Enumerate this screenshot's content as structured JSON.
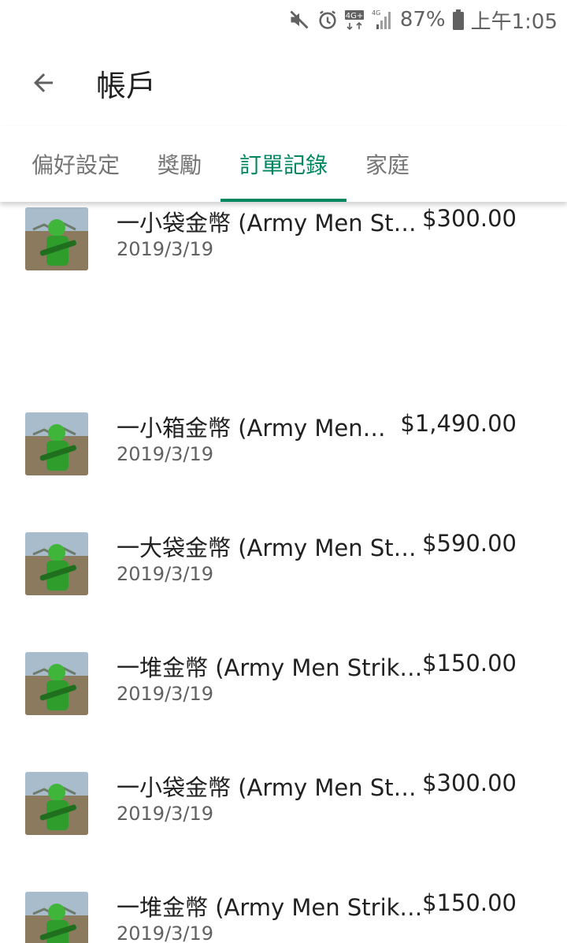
{
  "status_bar": {
    "battery": "87%",
    "time": "上午1:05",
    "network": "4G",
    "icons": [
      "mute-icon",
      "alarm-icon",
      "4g-icon",
      "signal-icon",
      "battery-icon"
    ]
  },
  "app_bar": {
    "title": "帳戶",
    "back_icon": "arrow-back-icon"
  },
  "tabs": [
    {
      "label": "偏好設定",
      "active": false
    },
    {
      "label": "獎勵",
      "active": false
    },
    {
      "label": "訂單記錄",
      "active": true
    },
    {
      "label": "家庭",
      "active": false
    }
  ],
  "accent_color": "#01875f",
  "orders": [
    {
      "title": "一小袋金幣 (Army Men St…",
      "price": "$300.00",
      "date": "2019/3/19"
    },
    {
      "title": "一小箱金幣 (Army Men…",
      "price": "$1,490.00",
      "date": "2019/3/19"
    },
    {
      "title": "一大袋金幣 (Army Men St…",
      "price": "$590.00",
      "date": "2019/3/19"
    },
    {
      "title": "一堆金幣 (Army Men Strik…",
      "price": "$150.00",
      "date": "2019/3/19"
    },
    {
      "title": "一小袋金幣 (Army Men St…",
      "price": "$300.00",
      "date": "2019/3/19"
    },
    {
      "title": "一堆金幣 (Army Men Strik…",
      "price": "$150.00",
      "date": "2019/3/19"
    }
  ]
}
